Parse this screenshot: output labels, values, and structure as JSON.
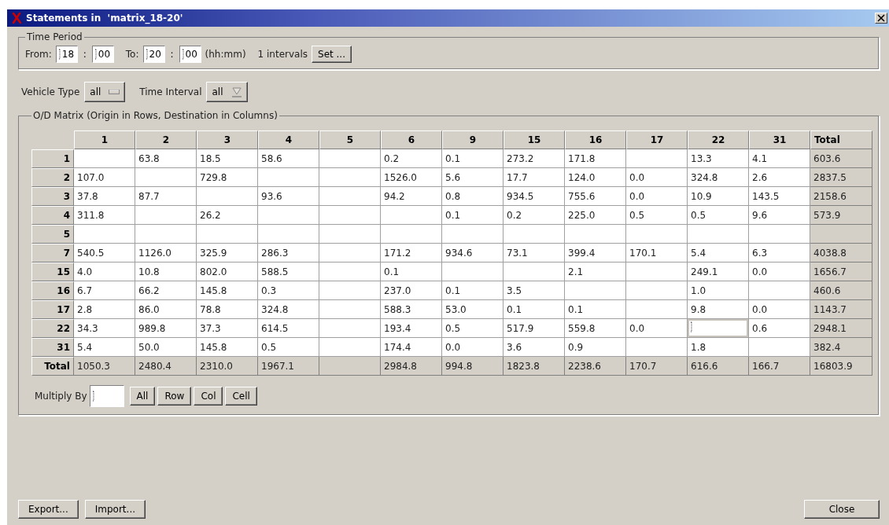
{
  "window": {
    "title": "Statements in  'matrix_18-20'"
  },
  "time_period": {
    "legend": "Time Period",
    "from_label": "From:",
    "from_hours": "18",
    "from_minutes": "00",
    "separator": ":",
    "to_label": "To:",
    "to_hours": "20",
    "to_minutes": "00",
    "format_hint": "(hh:mm)",
    "intervals": "1 intervals",
    "set_button": "Set ..."
  },
  "filters": [
    {
      "label": "Vehicle Type",
      "value": "all",
      "kind": "option"
    },
    {
      "label": "Time Interval",
      "value": "all",
      "kind": "combo"
    }
  ],
  "matrix": {
    "legend": "O/D Matrix (Origin in Rows, Destination in Columns)",
    "columns": [
      "1",
      "2",
      "3",
      "4",
      "5",
      "6",
      "9",
      "15",
      "16",
      "17",
      "22",
      "31"
    ],
    "total_column": "Total",
    "rows": [
      {
        "label": "1",
        "cells": [
          null,
          "63.8",
          "18.5",
          "58.6",
          null,
          "0.2",
          "0.1",
          "273.2",
          "171.8",
          null,
          "13.3",
          "4.1"
        ],
        "total": "603.6"
      },
      {
        "label": "2",
        "cells": [
          "107.0",
          null,
          "729.8",
          null,
          null,
          "1526.0",
          "5.6",
          "17.7",
          "124.0",
          "0.0",
          "324.8",
          "2.6"
        ],
        "total": "2837.5"
      },
      {
        "label": "3",
        "cells": [
          "37.8",
          "87.7",
          null,
          "93.6",
          null,
          "94.2",
          "0.8",
          "934.5",
          "755.6",
          "0.0",
          "10.9",
          "143.5"
        ],
        "total": "2158.6"
      },
      {
        "label": "4",
        "cells": [
          "311.8",
          null,
          "26.2",
          null,
          null,
          null,
          "0.1",
          "0.2",
          "225.0",
          "0.5",
          "0.5",
          "9.6"
        ],
        "total": "573.9"
      },
      {
        "label": "5",
        "cells": [
          null,
          null,
          null,
          null,
          null,
          null,
          null,
          null,
          null,
          null,
          null,
          null
        ]
      },
      {
        "label": "7",
        "cells": [
          "540.5",
          "1126.0",
          "325.9",
          "286.3",
          null,
          "171.2",
          "934.6",
          "73.1",
          "399.4",
          "170.1",
          "5.4",
          "6.3"
        ],
        "total": "4038.8"
      },
      {
        "label": "15",
        "cells": [
          "4.0",
          "10.8",
          "802.0",
          "588.5",
          null,
          "0.1",
          null,
          null,
          "2.1",
          null,
          "249.1",
          "0.0"
        ],
        "total": "1656.7"
      },
      {
        "label": "16",
        "cells": [
          "6.7",
          "66.2",
          "145.8",
          "0.3",
          null,
          "237.0",
          "0.1",
          "3.5",
          null,
          null,
          "1.0",
          null
        ],
        "total": "460.6"
      },
      {
        "label": "17",
        "cells": [
          "2.8",
          "86.0",
          "78.8",
          "324.8",
          null,
          "588.3",
          "53.0",
          "0.1",
          "0.1",
          null,
          "9.8",
          "0.0"
        ],
        "total": "1143.7"
      },
      {
        "label": "22",
        "cells": [
          "34.3",
          "989.8",
          "37.3",
          "614.5",
          null,
          "193.4",
          "0.5",
          "517.9",
          "559.8",
          "0.0",
          {
            "editing": true
          },
          "0.6"
        ],
        "total": "2948.1"
      },
      {
        "label": "31",
        "cells": [
          "5.4",
          "50.0",
          "145.8",
          "0.5",
          null,
          "174.4",
          "0.0",
          "3.6",
          "0.9",
          null,
          "1.8",
          null
        ],
        "total": "382.4"
      }
    ],
    "totals_row": {
      "label": "Total",
      "cells": [
        "1050.3",
        "2480.4",
        "2310.0",
        "1967.1",
        null,
        "2984.8",
        "994.8",
        "1823.8",
        "2238.6",
        "170.7",
        "616.6",
        "166.7"
      ],
      "total": "16803.9"
    },
    "multiply_label": "Multiply By",
    "multiply_buttons": [
      "All",
      "Row",
      "Col",
      "Cell"
    ]
  },
  "footer_buttons": [
    "Export...",
    "Import..."
  ],
  "close_button": "Close"
}
